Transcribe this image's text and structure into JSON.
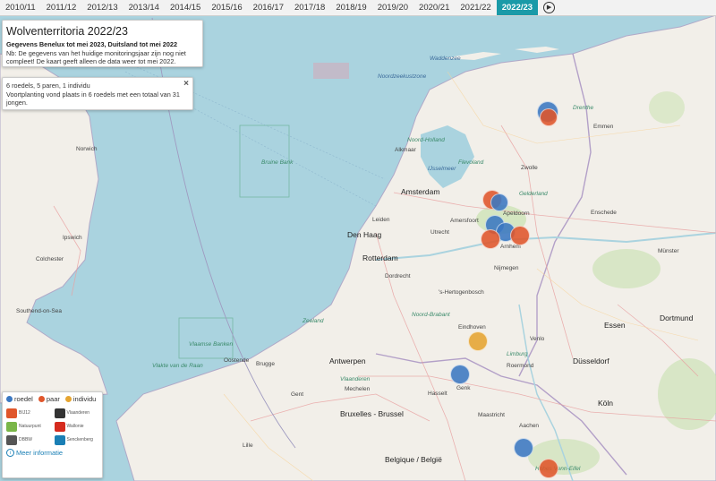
{
  "years": [
    "2010/11",
    "2011/12",
    "2012/13",
    "2013/14",
    "2014/15",
    "2015/16",
    "2016/17",
    "2017/18",
    "2018/19",
    "2019/20",
    "2020/21",
    "2021/22",
    "2022/23"
  ],
  "active_year": "2022/23",
  "title": {
    "heading": "Wolventerritoria 2022/23",
    "subtitle": "Gegevens Benelux tot mei 2023, Duitsland tot mei 2022",
    "note": "Nb: De gegevens van het huidige monitoringsjaar zijn nog niet compleet! De kaart geeft alleen de data weer tot mei 2022."
  },
  "popup": {
    "line1": "6 roedels, 5 paren, 1 individu",
    "line2": "Voortplanting vond plaats in 6 roedels met een totaal van 31 jongen.",
    "close": "×"
  },
  "legend": {
    "items": [
      {
        "label": "roedel",
        "color": "#3b78c2"
      },
      {
        "label": "paar",
        "color": "#e0562b"
      },
      {
        "label": "individu",
        "color": "#e6a531"
      }
    ],
    "logos": [
      "BIJ12",
      "Vlaanderen",
      "Natuurpunt",
      "Wallonie",
      "DBBW",
      "Senckenberg"
    ],
    "more_link": "Meer informatie"
  },
  "colors": {
    "roedel": "#3b78c2",
    "paar": "#e0562b",
    "individu": "#e6a531",
    "active_year_bg": "#1a9aa8"
  },
  "map_labels": {
    "colchester": "Colchester",
    "ipswich": "Ipswich",
    "norwich": "Norwich",
    "southend": "Southend-on-Sea",
    "amsterdam": "Amsterdam",
    "den_haag": "Den Haag",
    "rotterdam": "Rotterdam",
    "leiden": "Leiden",
    "utrecht": "Utrecht",
    "amersfoort": "Amersfoort",
    "apeldoorn": "Apeldoorn",
    "arnhem": "Arnhem",
    "nijmegen": "Nijmegen",
    "zwolle": "Zwolle",
    "emmen": "Emmen",
    "enschede": "Enschede",
    "eindhoven": "Eindhoven",
    "antwerpen": "Antwerpen",
    "brussel": "Bruxelles - Brussel",
    "gent": "Gent",
    "brugge": "Brugge",
    "lille": "Lille",
    "maastricht": "Maastricht",
    "aachen": "Aachen",
    "koln": "Köln",
    "dusseldorf": "Düsseldorf",
    "essen": "Essen",
    "dortmund": "Dortmund",
    "munster": "Münster",
    "roermond": "Roermond",
    "venlo": "Venlo",
    "hertogenbosch": "'s-Hertogenbosch",
    "belgique": "Belgique / België",
    "hohes_venn": "Hohes Venn-Eifel",
    "noord_holland": "Noord-Holland",
    "flevoland": "Flevoland",
    "gelderland": "Gelderland",
    "noord_brabant": "Noord-Brabant",
    "limburg": "Limburg",
    "vlaanderen": "Vlaanderen",
    "waddenzee": "Waddenzee",
    "noordzeekust": "Noordzeekustzone",
    "brown_bank": "Bruine Bank",
    "vlakte_raan": "Vlakte van de Raan",
    "vlaamse_banken": "Vlaamse Banken",
    "ijsselmeer": "IJsselmeer",
    "drenthe": "Drenthe",
    "alkmaar": "Alkmaar",
    "dordrecht": "Dordrecht",
    "mechelen": "Mechelen",
    "oostende": "Oostende",
    "genk": "Genk",
    "hasselt": "Hasselt",
    "zeeland": "Zeeland"
  },
  "markers": [
    {
      "type": "roedel"
    },
    {
      "type": "paar"
    },
    {
      "type": "paar"
    },
    {
      "type": "roedel"
    },
    {
      "type": "roedel"
    },
    {
      "type": "roedel"
    },
    {
      "type": "paar"
    },
    {
      "type": "paar"
    },
    {
      "type": "individu"
    },
    {
      "type": "roedel"
    },
    {
      "type": "roedel"
    },
    {
      "type": "paar"
    }
  ]
}
